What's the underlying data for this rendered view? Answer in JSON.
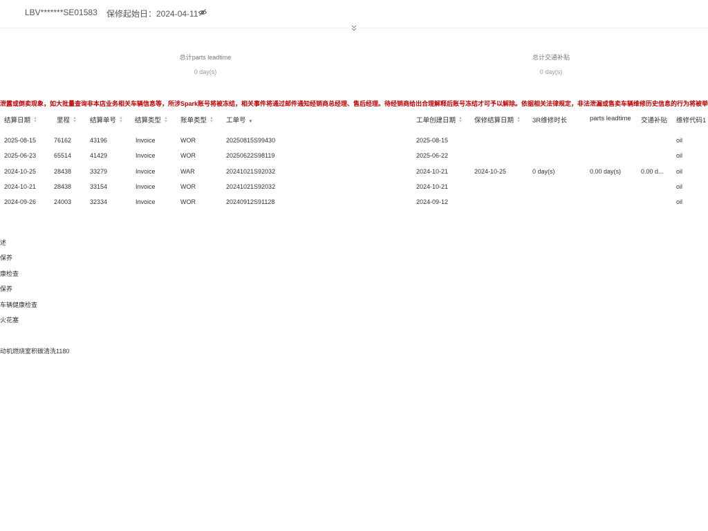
{
  "header": {
    "vin": "LBV*******SE01583",
    "warranty_start": "保修起始日：2024-04-11"
  },
  "summary": {
    "parts_label": "总计parts leadtime",
    "parts_value": "0 day(s)",
    "traffic_label": "总计交通补贴",
    "traffic_value": "0 day(s)"
  },
  "warning": "泄露或倒卖现象，如大批量查询非本店业务相关车辆信息等，所涉Spark账号将被冻结，相关事件将通过邮件通知经销商总经理、售后经理。待经销商给出合理解释后账号冻结才可予以解除。依据相关法律规定，非法泄漏或售卖车辆维修历史信息的行为将被举报至公安",
  "table": {
    "columns": [
      "结算日期",
      "里程",
      "结算单号",
      "结算类型",
      "账单类型",
      "工单号",
      "工单创建日期",
      "保修结算日期",
      "3R维修时长",
      "parts leadtime",
      "交通补贴",
      "维修代码1"
    ],
    "rows": [
      [
        "2025-08-15",
        "76162",
        "43196",
        "Invoice",
        "WOR",
        "20250815S99430",
        "2025-08-15",
        "",
        "",
        "",
        "",
        "oil"
      ],
      [
        "2025-06-23",
        "65514",
        "41429",
        "Invoice",
        "WOR",
        "20250622S98119",
        "2025-06-22",
        "",
        "",
        "",
        "",
        "oil"
      ],
      [
        "2024-10-25",
        "28438",
        "33279",
        "Invoice",
        "WAR",
        "20241021S92032",
        "2024-10-21",
        "2024-10-25",
        "0 day(s)",
        "0.00 day(s)",
        "0.00 d...",
        "oil"
      ],
      [
        "2024-10-21",
        "28438",
        "33154",
        "Invoice",
        "WOR",
        "20241021S92032",
        "2024-10-21",
        "",
        "",
        "",
        "",
        "oil"
      ],
      [
        "2024-09-26",
        "24003",
        "32334",
        "Invoice",
        "WOR",
        "20240912S91128",
        "2024-09-12",
        "",
        "",
        "",
        "",
        "oil"
      ]
    ]
  },
  "description_items": [
    "述",
    "保养",
    "康检查",
    "保养",
    "车辆健康检查",
    "火花塞",
    "",
    "动机燃烧室积碳清洗1180"
  ],
  "colors": {
    "warning": "#c00000",
    "sort_active": "#2d6ee0"
  },
  "icons": {
    "visibility": "eye-off-icon",
    "expand": "chevron-double-down-icon"
  }
}
